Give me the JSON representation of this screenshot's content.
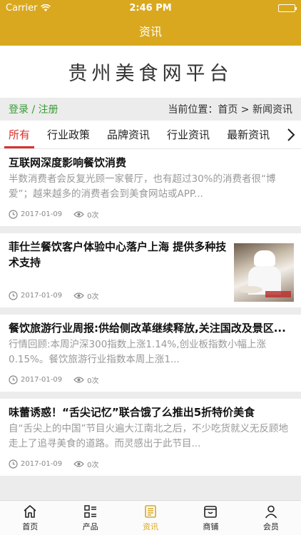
{
  "status_bar": {
    "carrier": "Carrier",
    "time": "2:46 PM"
  },
  "nav": {
    "title": "资讯"
  },
  "banner": {
    "site_name": "贵州美食网平台"
  },
  "location_bar": {
    "login_register": "登录 / 注册",
    "breadcrumb": "当前位置：首页 > 新闻资讯"
  },
  "tabs": [
    "所有",
    "行业政策",
    "品牌资讯",
    "行业资讯",
    "最新资讯"
  ],
  "articles": [
    {
      "title": "互联网深度影响餐饮消费",
      "summary": "半数消费者会反复光顾一家餐厅，也有超过30%的消费者很“博爱”；越来越多的消费者会到美食网站或APP...",
      "date": "2017-01-09",
      "views": "0次",
      "has_image": false
    },
    {
      "title": "菲仕兰餐饮客户体验中心落户上海 提供多种技术支持",
      "summary": "",
      "date": "2017-01-09",
      "views": "0次",
      "has_image": true,
      "image_label": "chef-photo"
    },
    {
      "title": "餐饮旅游行业周报:供给侧改革继续释放,关注国改及景区...",
      "summary": "行情回顾:本周沪深300指数上涨1.14%,创业板指数小幅上涨0.15%。餐饮旅游行业指数本周上涨1...",
      "date": "2017-01-09",
      "views": "0次",
      "has_image": false
    },
    {
      "title": "味蕾诱惑！“舌尖记忆”联合饿了么推出5折特价美食",
      "summary": "自“舌尖上的中国”节目火遍大江南北之后，不少吃货就义无反顾地走上了追寻美食的道路。而灵感出于此节目...",
      "date": "2017-01-09",
      "views": "0次",
      "has_image": false
    }
  ],
  "tab_bar": [
    {
      "label": "首页",
      "icon": "home-icon"
    },
    {
      "label": "产品",
      "icon": "grid-list-icon"
    },
    {
      "label": "资讯",
      "icon": "news-icon",
      "active": true
    },
    {
      "label": "商铺",
      "icon": "shop-icon"
    },
    {
      "label": "会员",
      "icon": "person-icon"
    }
  ],
  "colors": {
    "brand": "#d9a81e",
    "tab_active": "#d9312b",
    "login": "#3a9a36"
  }
}
